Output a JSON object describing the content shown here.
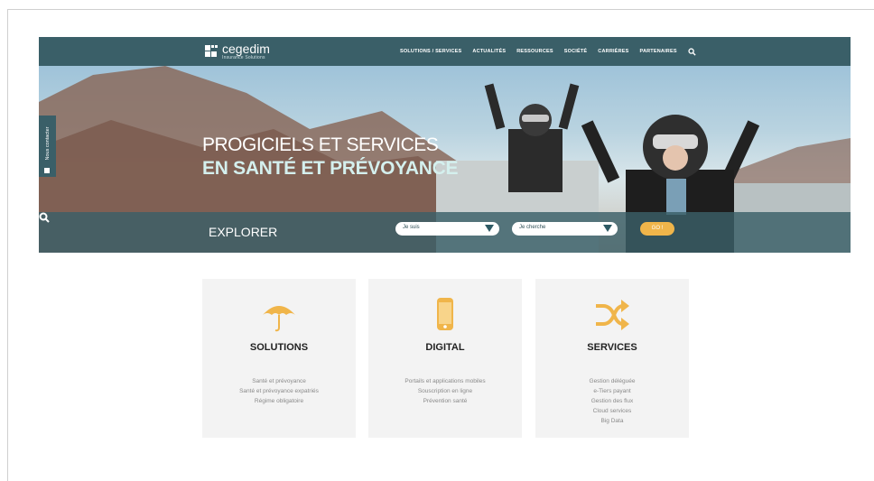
{
  "header": {
    "logo_name": "cegedim",
    "logo_sub": "Insurance Solutions",
    "nav": [
      {
        "label": "SOLUTIONS / SERVICES"
      },
      {
        "label": "ACTUALITÉS"
      },
      {
        "label": "RESSOURCES"
      },
      {
        "label": "SOCIÉTÉ"
      },
      {
        "label": "CARRIÈRES"
      },
      {
        "label": "PARTENAIRES"
      }
    ]
  },
  "hero": {
    "title_line1": "PROGICIELS ET SERVICES",
    "title_line2": "EN SANTÉ ET PRÉVOYANCE"
  },
  "explore": {
    "label": "EXPLORER",
    "select1": "Je suis",
    "select2": "Je cherche",
    "go": "GO !"
  },
  "contact_tab": {
    "label": "Nous contacter"
  },
  "cards": [
    {
      "icon": "umbrella-icon",
      "title": "SOLUTIONS",
      "lines": [
        "Santé et prévoyance",
        "Santé et prévoyance expatriés",
        "Régime obligatoire"
      ]
    },
    {
      "icon": "mobile-icon",
      "title": "DIGITAL",
      "lines": [
        "Portails et applications mobiles",
        "Souscription en ligne",
        "Prévention santé"
      ]
    },
    {
      "icon": "shuffle-icon",
      "title": "SERVICES",
      "lines": [
        "Gestion déléguée",
        "e-Tiers payant",
        "Gestion des flux",
        "Cloud services",
        "Big Data"
      ]
    }
  ],
  "colors": {
    "nav_bg": "#3a5f68",
    "accent": "#f0b54a",
    "card_bg": "#f3f3f3"
  }
}
